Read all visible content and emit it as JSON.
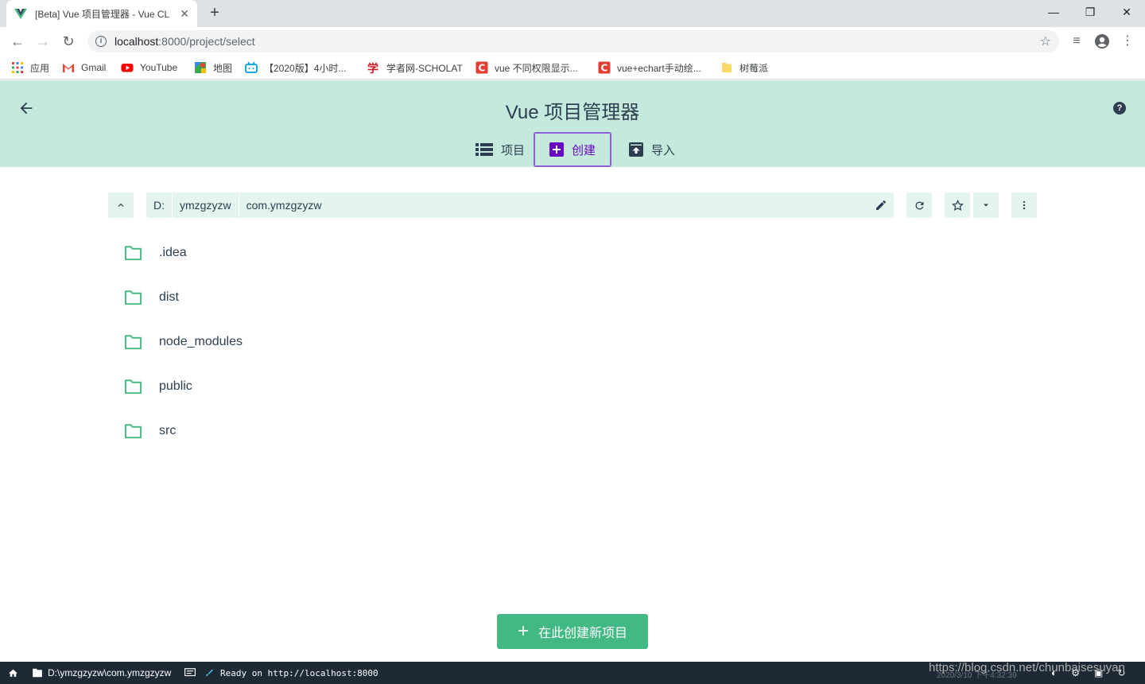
{
  "browser": {
    "tab_title": "[Beta] Vue 项目管理器 - Vue CLI",
    "url_host": "localhost",
    "url_rest": ":8000/project/select",
    "bookmarks": [
      {
        "label": "应用",
        "icon": "apps-grid-icon"
      },
      {
        "label": "Gmail",
        "icon": "gmail-icon"
      },
      {
        "label": "YouTube",
        "icon": "youtube-icon"
      },
      {
        "label": "地图",
        "icon": "maps-icon"
      },
      {
        "label": "【2020版】4小时...",
        "icon": "bilibili-icon"
      },
      {
        "label": "学者网-SCHOLAT",
        "icon": "scholat-icon"
      },
      {
        "label": "vue 不同权限显示...",
        "icon": "csdn-icon"
      },
      {
        "label": "vue+echart手动绘...",
        "icon": "csdn-icon"
      },
      {
        "label": "树莓派",
        "icon": "folder-icon"
      }
    ]
  },
  "header": {
    "title": "Vue 项目管理器",
    "tabs": [
      {
        "label": "项目",
        "icon": "list-icon"
      },
      {
        "label": "创建",
        "icon": "add-box-icon",
        "active": true
      },
      {
        "label": "导入",
        "icon": "unarchive-icon"
      }
    ]
  },
  "pathbar": {
    "segments": [
      "D:",
      "ymzgzyzw",
      "com.ymzgzyzw"
    ]
  },
  "folders": [
    ".idea",
    "dist",
    "node_modules",
    "public",
    "src"
  ],
  "create_button": {
    "label": "在此创建新项目"
  },
  "statusbar": {
    "cwd": "D:\\ymzgzyzw\\com.ymzgzyzw",
    "log": "Ready on http://localhost:8000",
    "time": "2020/3/10 下午4:32:39"
  },
  "watermark": "https://blog.csdn.net/chunbaisesuyan",
  "colors": {
    "accent": "#42b983",
    "header_bg": "#c5eadd",
    "active_tab": "#6806c1",
    "statusbar": "#1d2935"
  }
}
